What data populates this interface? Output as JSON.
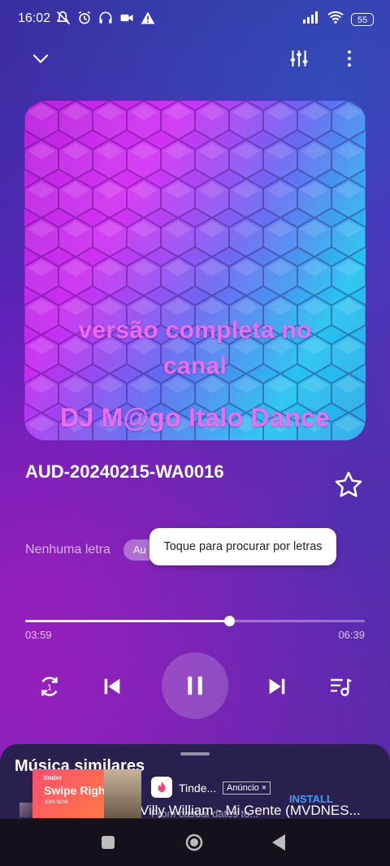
{
  "status_bar": {
    "time": "16:02",
    "battery": "55",
    "left_icons": [
      "mute-icon",
      "alarm-icon",
      "headphones-icon",
      "video-camera-icon",
      "warning-icon"
    ],
    "right_icons": [
      "signal-icon",
      "wifi-icon",
      "battery-icon"
    ]
  },
  "top_bar": {
    "icons": [
      "chevron-down-icon",
      "equalizer-icon",
      "more-vertical-icon"
    ]
  },
  "album_art": {
    "line1": "versão completa no",
    "line2": "canal",
    "line3": "DJ M@go Italo Dance"
  },
  "track": {
    "title": "AUD-20240215-WA0016",
    "favorite_icon": "star-outline-icon"
  },
  "lyrics": {
    "label": "Nenhuma letra",
    "chip": "Au",
    "tooltip": "Toque para procurar por letras"
  },
  "progress": {
    "elapsed": "03:59",
    "duration": "06:39",
    "fraction": 0.6
  },
  "controls": {
    "icons": [
      "repeat-one-icon",
      "previous-icon",
      "pause-icon",
      "next-icon",
      "queue-icon"
    ]
  },
  "similar": {
    "title": "Música similares",
    "song": "Villy William - Mi Gente (MVDNES..."
  },
  "ad": {
    "banner_brand": "tinder",
    "banner_headline": "Swipe Right",
    "banner_cta": "JOIN NOW",
    "app_name": "Tinde...",
    "badge": "Anúncio ×",
    "description": "From casual dates to...",
    "install": "INSTALL"
  },
  "nav_bar": {
    "icons": [
      "recents-icon",
      "home-icon",
      "back-icon"
    ]
  },
  "colors": {
    "accent_art_text": "#ee6cf0",
    "install_blue": "#3aa1ff"
  }
}
